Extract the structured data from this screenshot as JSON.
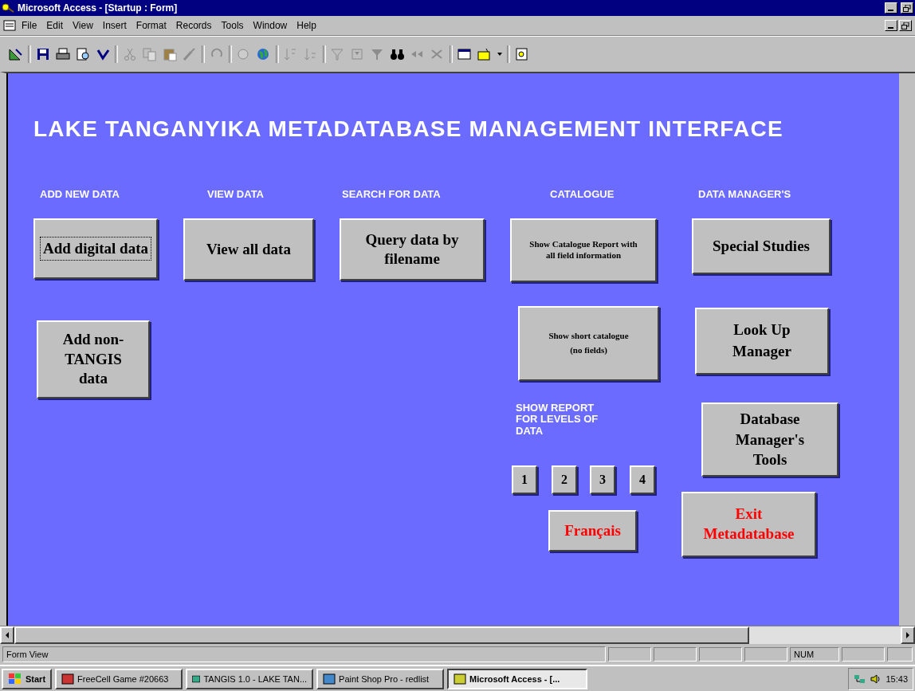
{
  "window": {
    "title": "Microsoft Access - [Startup : Form]"
  },
  "menu": [
    "File",
    "Edit",
    "View",
    "Insert",
    "Format",
    "Records",
    "Tools",
    "Window",
    "Help"
  ],
  "form": {
    "title": "LAKE TANGANYIKA METADATABASE MANAGEMENT INTERFACE",
    "headings": [
      "ADD NEW DATA",
      "VIEW DATA",
      "SEARCH FOR DATA",
      "CATALOGUE",
      "DATA MANAGER'S",
      "SHOW REPORT FOR LEVELS OF DATA"
    ],
    "buttons": [
      {
        "label": "Add  digital data",
        "focused": true,
        "color": "#000000"
      },
      {
        "label": "View all  data",
        "focused": false,
        "color": "#000000"
      },
      {
        "label": "Query data by filename",
        "focused": false,
        "color": "#000000"
      },
      {
        "label": "Show Catalogue Report with all field information",
        "focused": false,
        "color": "#000000"
      },
      {
        "label": "Special Studies",
        "focused": false,
        "color": "#000000"
      },
      {
        "label": "Add non-TANGIS data",
        "focused": false,
        "color": "#000000"
      },
      {
        "label": "Show short catalogue (no fields)",
        "focused": false,
        "color": "#000000"
      },
      {
        "label": "Look Up Manager",
        "focused": false,
        "color": "#000000"
      },
      {
        "label": "Database Manager's Tools",
        "focused": false,
        "color": "#000000"
      },
      {
        "label": "1",
        "focused": false,
        "color": "#000000"
      },
      {
        "label": "2",
        "focused": false,
        "color": "#000000"
      },
      {
        "label": "3",
        "focused": false,
        "color": "#000000"
      },
      {
        "label": "4",
        "focused": false,
        "color": "#000000"
      },
      {
        "label": "Français",
        "focused": false,
        "color": "#ff0000"
      },
      {
        "label": "Exit Metadatabase",
        "focused": false,
        "color": "#ff0000"
      }
    ]
  },
  "status_bar": {
    "text": "Form View",
    "indicator": "NUM"
  },
  "taskbar": {
    "start": "Start",
    "items": [
      {
        "label": "FreeCell Game #20663",
        "selected": false
      },
      {
        "label": "TANGIS 1.0 - LAKE TAN...",
        "selected": false
      },
      {
        "label": "Paint Shop Pro - redlist",
        "selected": false
      },
      {
        "label": "Microsoft Access - [...",
        "selected": true
      }
    ],
    "clock": "15:43"
  }
}
